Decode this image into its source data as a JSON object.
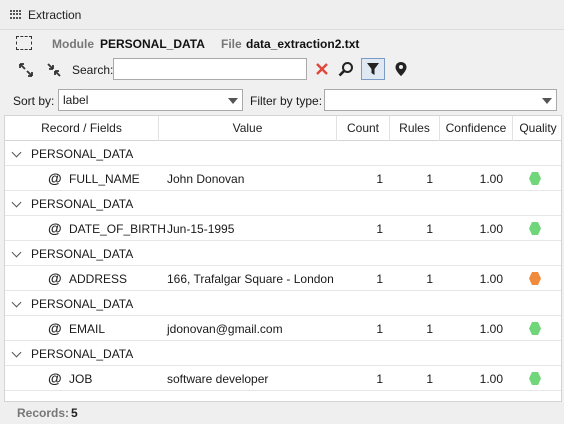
{
  "panel": {
    "title": "Extraction"
  },
  "info": {
    "module_label": "Module",
    "module_value": "PERSONAL_DATA",
    "file_label": "File",
    "file_value": "data_extraction2.txt"
  },
  "toolbar": {
    "search_label": "Search:",
    "search_value": "",
    "icons": [
      "expand-icon",
      "collapse-icon",
      "clear-icon",
      "search-icon",
      "filter-icon",
      "location-pin-icon"
    ]
  },
  "sort": {
    "label": "Sort by:",
    "value": "label"
  },
  "filter": {
    "label": "Filter by type:",
    "value": ""
  },
  "columns": [
    "Record / Fields",
    "Value",
    "Count",
    "Rules",
    "Confidence",
    "Quality"
  ],
  "groups": [
    {
      "label": "PERSONAL_DATA",
      "field": {
        "name": "FULL_NAME",
        "value": "John Donovan",
        "count": "1",
        "rules": "1",
        "confidence": "1.00",
        "quality_color": "#6fd67a"
      }
    },
    {
      "label": "PERSONAL_DATA",
      "field": {
        "name": "DATE_OF_BIRTH",
        "value": "Jun-15-1995",
        "count": "1",
        "rules": "1",
        "confidence": "1.00",
        "quality_color": "#6fd67a"
      }
    },
    {
      "label": "PERSONAL_DATA",
      "field": {
        "name": "ADDRESS",
        "value": "166, Trafalgar Square - London",
        "count": "1",
        "rules": "1",
        "confidence": "1.00",
        "quality_color": "#f08a3c"
      }
    },
    {
      "label": "PERSONAL_DATA",
      "field": {
        "name": "EMAIL",
        "value": "jdonovan@gmail.com",
        "count": "1",
        "rules": "1",
        "confidence": "1.00",
        "quality_color": "#6fd67a"
      }
    },
    {
      "label": "PERSONAL_DATA",
      "field": {
        "name": "JOB",
        "value": "software developer",
        "count": "1",
        "rules": "1",
        "confidence": "1.00",
        "quality_color": "#6fd67a"
      }
    }
  ],
  "status": {
    "records_label": "Records:",
    "records_value": "5"
  }
}
